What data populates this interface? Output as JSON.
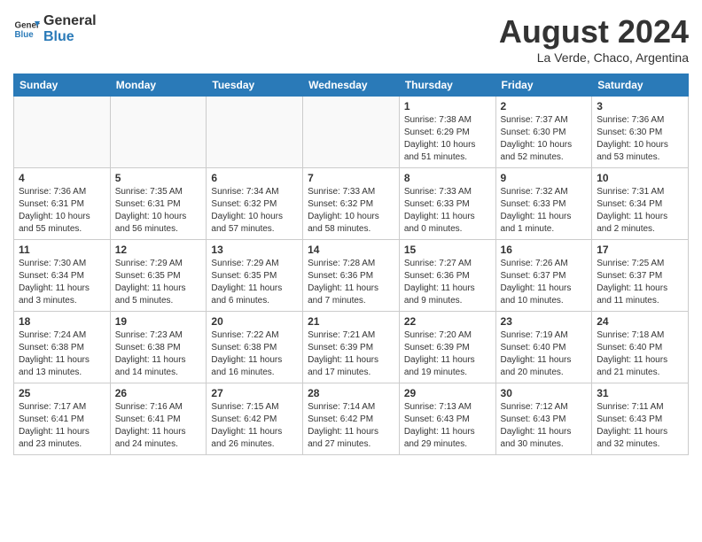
{
  "header": {
    "logo_line1": "General",
    "logo_line2": "Blue",
    "month_year": "August 2024",
    "location": "La Verde, Chaco, Argentina"
  },
  "weekdays": [
    "Sunday",
    "Monday",
    "Tuesday",
    "Wednesday",
    "Thursday",
    "Friday",
    "Saturday"
  ],
  "weeks": [
    [
      {
        "day": "",
        "info": ""
      },
      {
        "day": "",
        "info": ""
      },
      {
        "day": "",
        "info": ""
      },
      {
        "day": "",
        "info": ""
      },
      {
        "day": "1",
        "info": "Sunrise: 7:38 AM\nSunset: 6:29 PM\nDaylight: 10 hours\nand 51 minutes."
      },
      {
        "day": "2",
        "info": "Sunrise: 7:37 AM\nSunset: 6:30 PM\nDaylight: 10 hours\nand 52 minutes."
      },
      {
        "day": "3",
        "info": "Sunrise: 7:36 AM\nSunset: 6:30 PM\nDaylight: 10 hours\nand 53 minutes."
      }
    ],
    [
      {
        "day": "4",
        "info": "Sunrise: 7:36 AM\nSunset: 6:31 PM\nDaylight: 10 hours\nand 55 minutes."
      },
      {
        "day": "5",
        "info": "Sunrise: 7:35 AM\nSunset: 6:31 PM\nDaylight: 10 hours\nand 56 minutes."
      },
      {
        "day": "6",
        "info": "Sunrise: 7:34 AM\nSunset: 6:32 PM\nDaylight: 10 hours\nand 57 minutes."
      },
      {
        "day": "7",
        "info": "Sunrise: 7:33 AM\nSunset: 6:32 PM\nDaylight: 10 hours\nand 58 minutes."
      },
      {
        "day": "8",
        "info": "Sunrise: 7:33 AM\nSunset: 6:33 PM\nDaylight: 11 hours\nand 0 minutes."
      },
      {
        "day": "9",
        "info": "Sunrise: 7:32 AM\nSunset: 6:33 PM\nDaylight: 11 hours\nand 1 minute."
      },
      {
        "day": "10",
        "info": "Sunrise: 7:31 AM\nSunset: 6:34 PM\nDaylight: 11 hours\nand 2 minutes."
      }
    ],
    [
      {
        "day": "11",
        "info": "Sunrise: 7:30 AM\nSunset: 6:34 PM\nDaylight: 11 hours\nand 3 minutes."
      },
      {
        "day": "12",
        "info": "Sunrise: 7:29 AM\nSunset: 6:35 PM\nDaylight: 11 hours\nand 5 minutes."
      },
      {
        "day": "13",
        "info": "Sunrise: 7:29 AM\nSunset: 6:35 PM\nDaylight: 11 hours\nand 6 minutes."
      },
      {
        "day": "14",
        "info": "Sunrise: 7:28 AM\nSunset: 6:36 PM\nDaylight: 11 hours\nand 7 minutes."
      },
      {
        "day": "15",
        "info": "Sunrise: 7:27 AM\nSunset: 6:36 PM\nDaylight: 11 hours\nand 9 minutes."
      },
      {
        "day": "16",
        "info": "Sunrise: 7:26 AM\nSunset: 6:37 PM\nDaylight: 11 hours\nand 10 minutes."
      },
      {
        "day": "17",
        "info": "Sunrise: 7:25 AM\nSunset: 6:37 PM\nDaylight: 11 hours\nand 11 minutes."
      }
    ],
    [
      {
        "day": "18",
        "info": "Sunrise: 7:24 AM\nSunset: 6:38 PM\nDaylight: 11 hours\nand 13 minutes."
      },
      {
        "day": "19",
        "info": "Sunrise: 7:23 AM\nSunset: 6:38 PM\nDaylight: 11 hours\nand 14 minutes."
      },
      {
        "day": "20",
        "info": "Sunrise: 7:22 AM\nSunset: 6:38 PM\nDaylight: 11 hours\nand 16 minutes."
      },
      {
        "day": "21",
        "info": "Sunrise: 7:21 AM\nSunset: 6:39 PM\nDaylight: 11 hours\nand 17 minutes."
      },
      {
        "day": "22",
        "info": "Sunrise: 7:20 AM\nSunset: 6:39 PM\nDaylight: 11 hours\nand 19 minutes."
      },
      {
        "day": "23",
        "info": "Sunrise: 7:19 AM\nSunset: 6:40 PM\nDaylight: 11 hours\nand 20 minutes."
      },
      {
        "day": "24",
        "info": "Sunrise: 7:18 AM\nSunset: 6:40 PM\nDaylight: 11 hours\nand 21 minutes."
      }
    ],
    [
      {
        "day": "25",
        "info": "Sunrise: 7:17 AM\nSunset: 6:41 PM\nDaylight: 11 hours\nand 23 minutes."
      },
      {
        "day": "26",
        "info": "Sunrise: 7:16 AM\nSunset: 6:41 PM\nDaylight: 11 hours\nand 24 minutes."
      },
      {
        "day": "27",
        "info": "Sunrise: 7:15 AM\nSunset: 6:42 PM\nDaylight: 11 hours\nand 26 minutes."
      },
      {
        "day": "28",
        "info": "Sunrise: 7:14 AM\nSunset: 6:42 PM\nDaylight: 11 hours\nand 27 minutes."
      },
      {
        "day": "29",
        "info": "Sunrise: 7:13 AM\nSunset: 6:43 PM\nDaylight: 11 hours\nand 29 minutes."
      },
      {
        "day": "30",
        "info": "Sunrise: 7:12 AM\nSunset: 6:43 PM\nDaylight: 11 hours\nand 30 minutes."
      },
      {
        "day": "31",
        "info": "Sunrise: 7:11 AM\nSunset: 6:43 PM\nDaylight: 11 hours\nand 32 minutes."
      }
    ]
  ]
}
